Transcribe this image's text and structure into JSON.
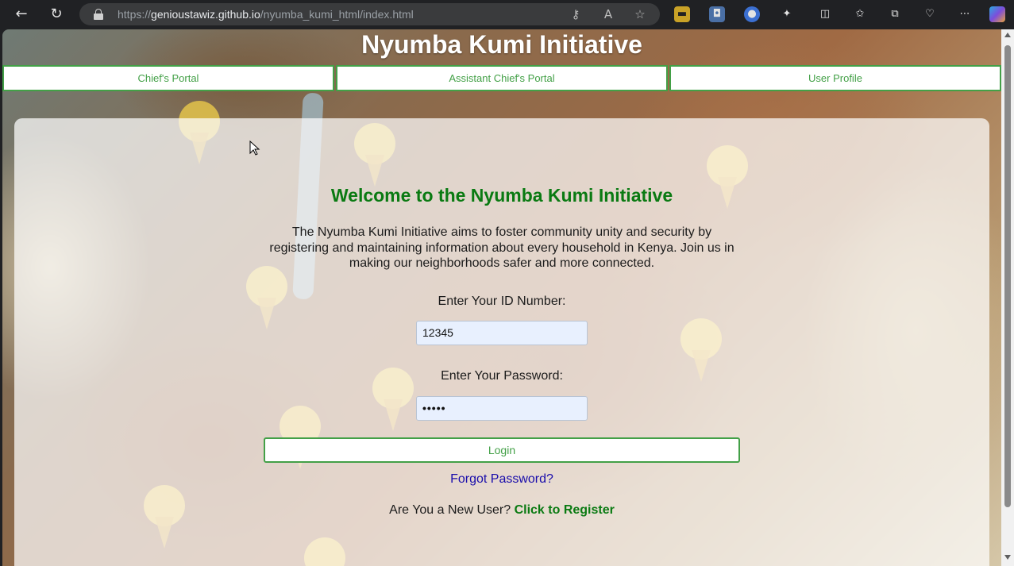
{
  "browser": {
    "url_prefix": "https://",
    "url_host": "genioustawiz.github.io",
    "url_path": "/nyumba_kumi_html/index.html"
  },
  "page": {
    "title": "Nyumba Kumi Initiative",
    "nav": [
      {
        "label": "Chief's Portal"
      },
      {
        "label": "Assistant Chief's Portal"
      },
      {
        "label": "User Profile"
      }
    ],
    "welcome": "Welcome to the Nyumba Kumi Initiative",
    "intro": "The Nyumba Kumi Initiative aims to foster community unity and security by registering and maintaining information about every household in Kenya. Join us in making our neighborhoods safer and more connected.",
    "id_label": "Enter Your ID Number:",
    "id_value": "12345",
    "password_label": "Enter Your Password:",
    "password_value": "•••••",
    "login_label": "Login",
    "forgot_label": "Forgot Password?",
    "new_user_text": "Are You a New User?",
    "register_label": "Click to Register"
  },
  "colors": {
    "accent_green": "#43a047",
    "heading_green": "#0a7a12",
    "link_blue": "#1a0dab"
  }
}
